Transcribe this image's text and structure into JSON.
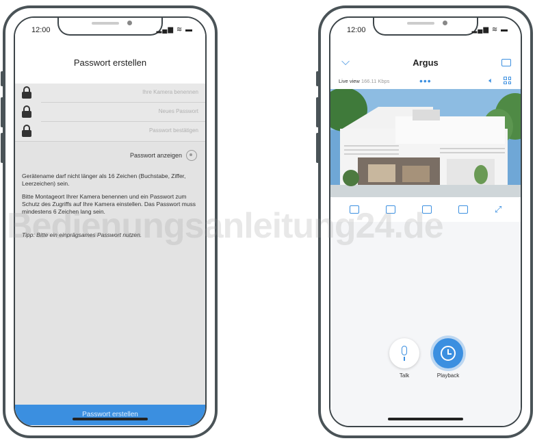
{
  "left_phone": {
    "status_time": "12:00",
    "status_icons": "▂▄▆ ≋ ▬",
    "title": "Passwort erstellen",
    "fields": [
      {
        "placeholder": "Ihre Kamera benennen",
        "icon": "lock-icon"
      },
      {
        "placeholder": "Neues Passwort",
        "icon": "lock-icon"
      },
      {
        "placeholder": "Passwort bestätigen",
        "icon": "lock-icon"
      }
    ],
    "show_password_label": "Passwort anzeigen",
    "info1": "Gerätename darf nicht länger als 16 Zeichen (Buchstabe, Ziffer, Leerzeichen) sein.",
    "info2": "Bitte Montageort Ihrer Kamera benennen und ein Passwort zum Schutz des Zugriffs auf Ihre Kamera einstellen. Das Passwort muss mindestens 6 Zeichen lang sein.",
    "tip": "Tipp: Bitte ein einprägsames Passwort nutzen.",
    "cta_label": "Passwort erstellen"
  },
  "right_phone": {
    "status_time": "12:00",
    "status_icons": "▂▄▆ ≋ ▬",
    "title": "Argus",
    "live_view_label": "Live view",
    "live_view_sub": "166.11 Kbps",
    "dots": "•••",
    "talk_label": "Talk",
    "playback_label": "Playback",
    "accent": "#3b8fe0"
  },
  "watermark": "Bedienungsanleitung24.de"
}
